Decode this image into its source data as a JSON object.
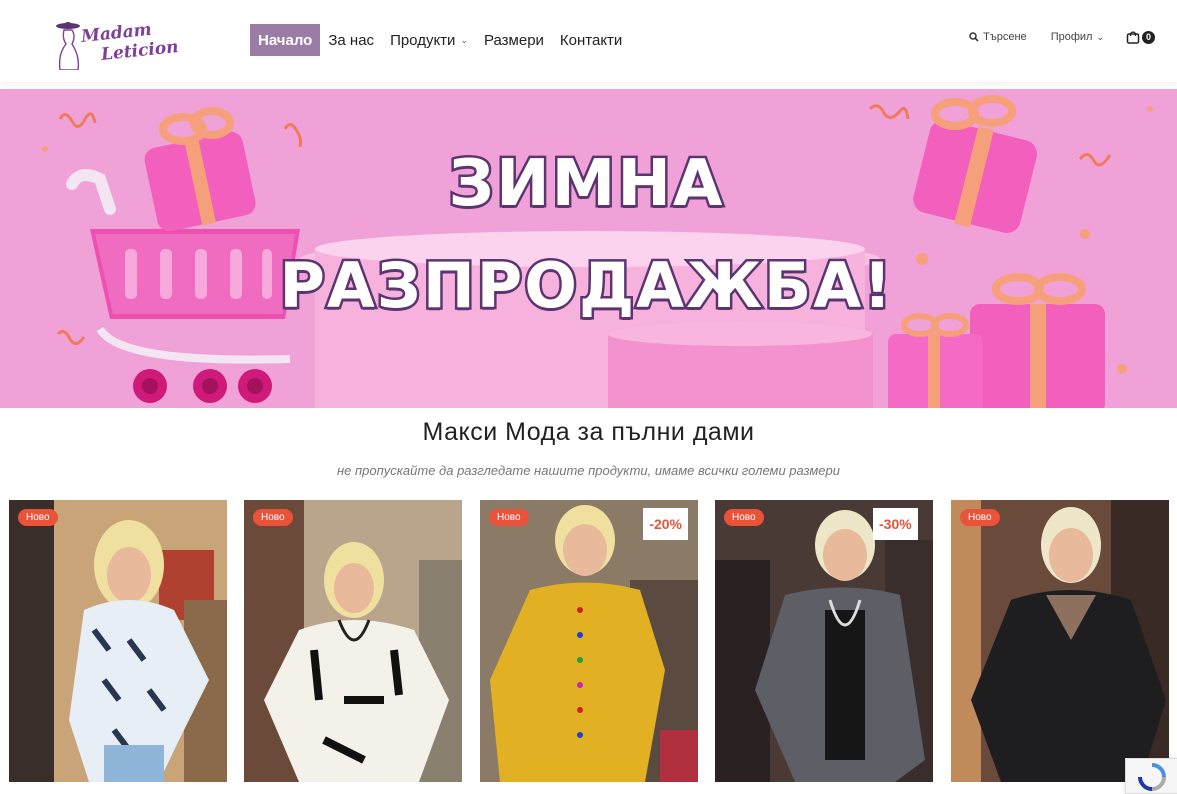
{
  "header": {
    "logo_line1": "Madam",
    "logo_line2": "Leticion",
    "nav": [
      {
        "label": "Начало",
        "active": true
      },
      {
        "label": "За нас"
      },
      {
        "label": "Продукти",
        "has_dropdown": true
      },
      {
        "label": "Размери"
      },
      {
        "label": "Контакти"
      }
    ],
    "search_label": "Търсене",
    "profile_label": "Профил",
    "cart_count": "0"
  },
  "banner": {
    "line1": "ЗИМНА",
    "line2": "РАЗПРОДАЖБА!"
  },
  "section": {
    "title": "Макси Мода за пълни дами",
    "subtitle": "не пропускайте да разгледате нашите продукти, имаме всички големи размери"
  },
  "products": [
    {
      "badge": "Ново",
      "discount": ""
    },
    {
      "badge": "Ново",
      "discount": ""
    },
    {
      "badge": "Ново",
      "discount": "-20%"
    },
    {
      "badge": "Ново",
      "discount": "-30%"
    },
    {
      "badge": "Ново",
      "discount": ""
    }
  ],
  "colors": {
    "accent": "#9b7ca6",
    "banner_bg": "#f0a2d8",
    "badge": "#e8533a",
    "title_outline": "#5a3570"
  }
}
